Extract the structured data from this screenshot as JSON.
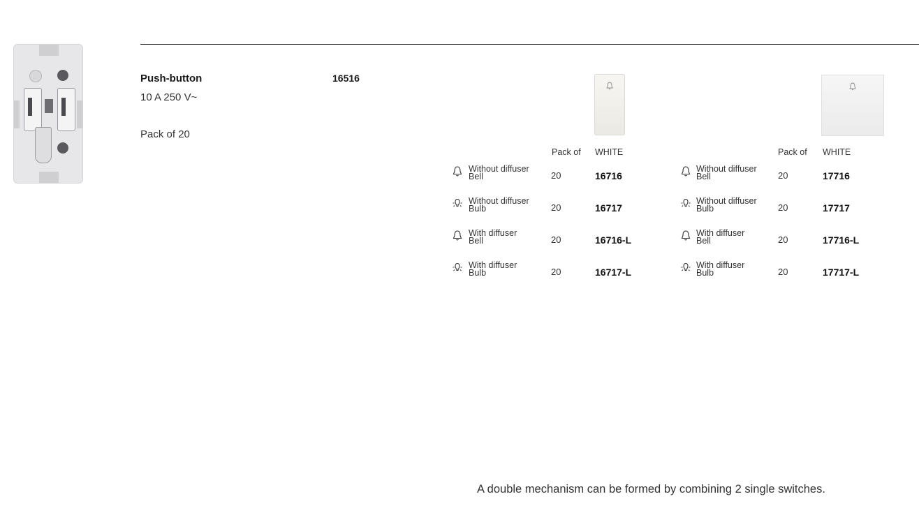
{
  "product": {
    "title": "Push-button",
    "spec": "10 A 250 V~",
    "pack": "Pack of 20",
    "code": "16516"
  },
  "tables": [
    {
      "header_pack": "Pack of",
      "header_color": "WHITE",
      "rows": [
        {
          "icon": "bell-icon",
          "line1": "Without diffuser",
          "line2": "Bell",
          "qty": "20",
          "ref": "16716"
        },
        {
          "icon": "bulb-icon",
          "line1": "Without diffuser",
          "line2": "Bulb",
          "qty": "20",
          "ref": "16717"
        },
        {
          "icon": "bell-icon",
          "line1": "With diffuser",
          "line2": "Bell",
          "qty": "20",
          "ref": "16716-L"
        },
        {
          "icon": "bulb-icon",
          "line1": "With diffuser",
          "line2": "Bulb",
          "qty": "20",
          "ref": "16717-L"
        }
      ]
    },
    {
      "header_pack": "Pack of",
      "header_color": "WHITE",
      "rows": [
        {
          "icon": "bell-icon",
          "line1": "Without diffuser",
          "line2": "Bell",
          "qty": "20",
          "ref": "17716"
        },
        {
          "icon": "bulb-icon",
          "line1": "Without diffuser",
          "line2": "Bulb",
          "qty": "20",
          "ref": "17717"
        },
        {
          "icon": "bell-icon",
          "line1": "With diffuser",
          "line2": "Bell",
          "qty": "20",
          "ref": "17716-L"
        },
        {
          "icon": "bulb-icon",
          "line1": "With diffuser",
          "line2": "Bulb",
          "qty": "20",
          "ref": "17717-L"
        }
      ]
    }
  ],
  "note": "A double mechanism can be formed by combining 2 single switches."
}
